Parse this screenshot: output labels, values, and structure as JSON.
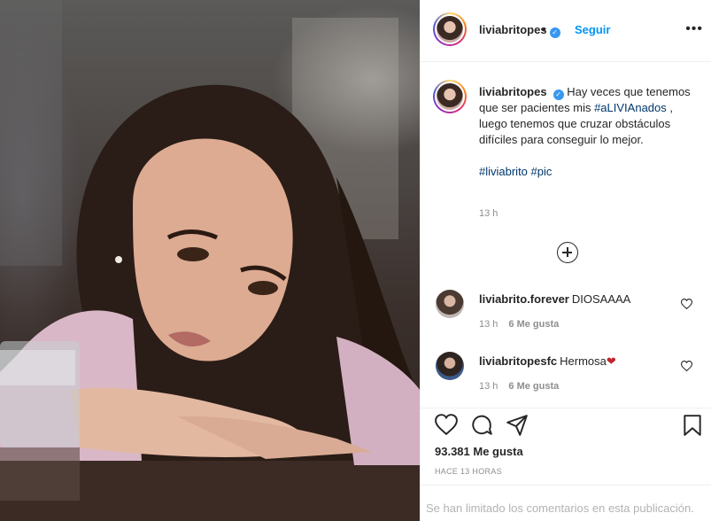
{
  "header": {
    "username": "liviabritopes",
    "separator": "•",
    "follow_label": "Seguir",
    "more_label": "•••"
  },
  "caption": {
    "username": "liviabritopes",
    "text_before": "Hay veces que tenemos que ser pacientes mis ",
    "hashtag_1": "#aLIVIAnados",
    "text_after": " , luego tenemos que cruzar obstáculos difíciles para conseguir lo mejor.",
    "hashtag_2": "#liviabrito",
    "hashtag_3": "#pic",
    "time": "13 h"
  },
  "comments": [
    {
      "username": "liviabrito.forever",
      "text": "DIOSAAAA",
      "time": "13 h",
      "likes": "6 Me gusta"
    },
    {
      "username": "liviabritopesfc",
      "text": "Hermosa❤",
      "time": "13 h",
      "likes": "6 Me gusta"
    }
  ],
  "post": {
    "likes": "93.381 Me gusta",
    "posted": "HACE 13 HORAS",
    "comments_limited": "Se han limitado los comentarios en esta publicación."
  },
  "colors": {
    "link_blue": "#0095f6",
    "hashtag": "#00376b",
    "meta_gray": "#8e8e8e",
    "heart_red": "#c0262d"
  },
  "icons": [
    "verified-badge-icon",
    "more-options-icon",
    "load-more-comments-icon",
    "heart-icon",
    "comment-icon",
    "share-icon",
    "bookmark-icon"
  ]
}
